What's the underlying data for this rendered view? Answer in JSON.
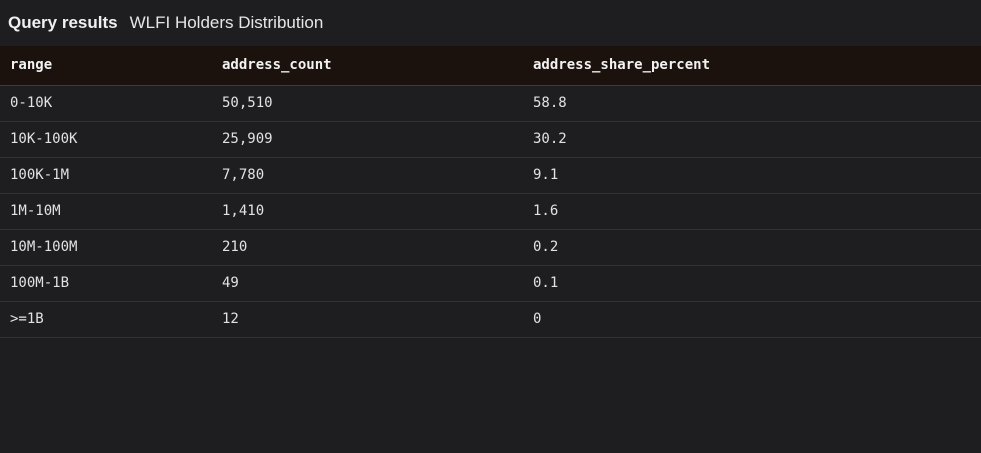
{
  "header": {
    "title": "Query results",
    "subtitle": "WLFI Holders Distribution"
  },
  "table": {
    "columns": [
      "range",
      "address_count",
      "address_share_percent"
    ],
    "rows": [
      [
        "0-10K",
        "50,510",
        "58.8"
      ],
      [
        "10K-100K",
        "25,909",
        "30.2"
      ],
      [
        "100K-1M",
        "7,780",
        "9.1"
      ],
      [
        "1M-10M",
        "1,410",
        "1.6"
      ],
      [
        "10M-100M",
        "210",
        "0.2"
      ],
      [
        "100M-1B",
        "49",
        "0.1"
      ],
      [
        ">=1B",
        "12",
        "0"
      ]
    ]
  },
  "colors": {
    "background": "#1e1e20",
    "header_row_background": "#1b110d",
    "row_border": "#333336"
  }
}
